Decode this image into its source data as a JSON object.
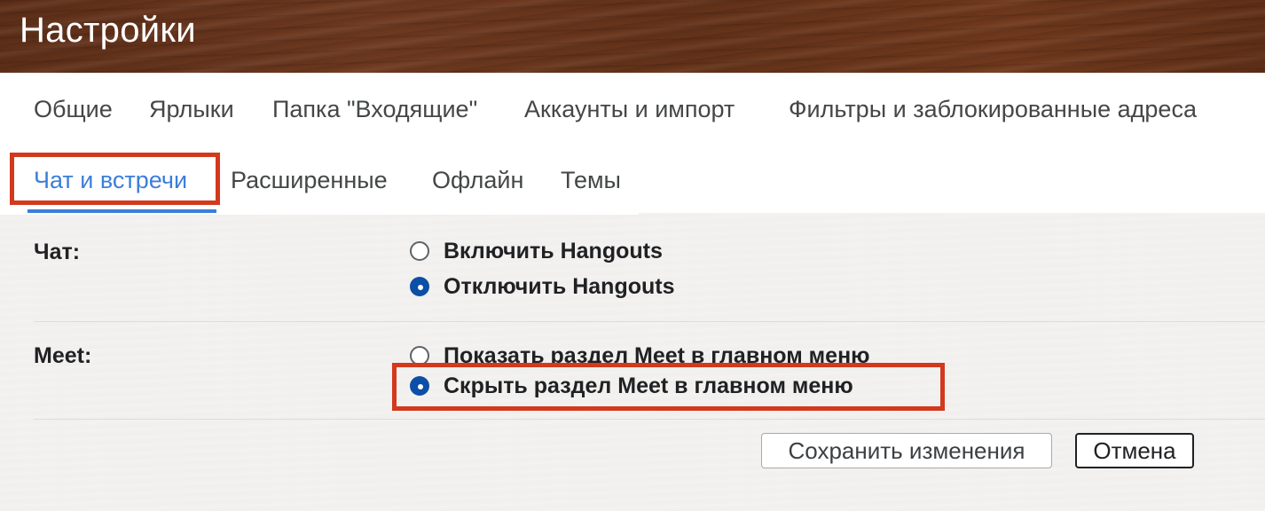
{
  "header": {
    "title": "Настройки"
  },
  "tabs": {
    "row1": [
      {
        "label": "Общие"
      },
      {
        "label": "Ярлыки"
      },
      {
        "label": "Папка \"Входящие\""
      },
      {
        "label": "Аккаунты и импорт"
      },
      {
        "label": "Фильтры и заблокированные адреса"
      }
    ],
    "row2": [
      {
        "label": "Чат и встречи",
        "active": true
      },
      {
        "label": "Расширенные"
      },
      {
        "label": "Офлайн"
      },
      {
        "label": "Темы"
      }
    ]
  },
  "settings": {
    "chat": {
      "label": "Чат:",
      "options": [
        {
          "label": "Включить Hangouts",
          "selected": false
        },
        {
          "label": "Отключить Hangouts",
          "selected": true
        }
      ]
    },
    "meet": {
      "label": "Meet:",
      "options": [
        {
          "label": "Показать раздел Meet в главном меню",
          "selected": false
        },
        {
          "label": "Скрыть раздел Meet в главном меню",
          "selected": true
        }
      ]
    }
  },
  "buttons": {
    "save": "Сохранить изменения",
    "cancel": "Отмена"
  },
  "colors": {
    "accent": "#3c7ed9",
    "highlight": "#d2391d",
    "radio_selected": "#0b4fa6"
  }
}
